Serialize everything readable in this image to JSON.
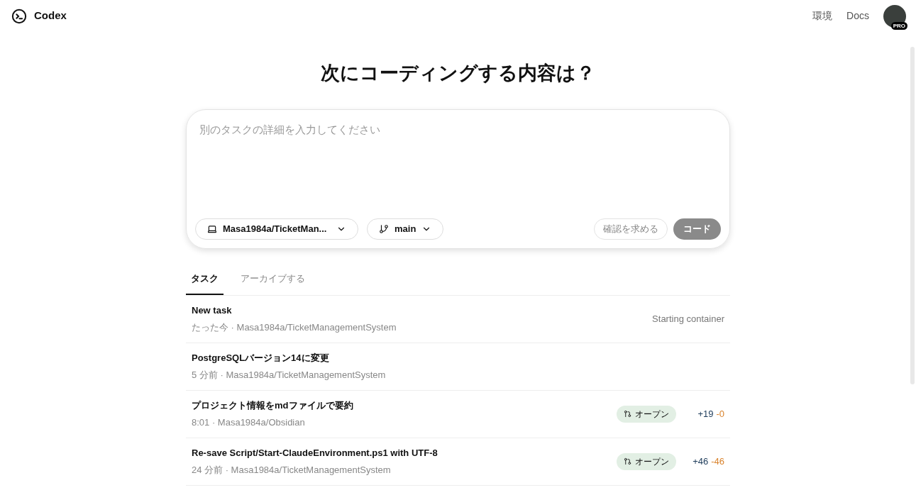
{
  "header": {
    "brand": "Codex",
    "links": [
      "環境",
      "Docs"
    ],
    "avatar_badge": "PRO"
  },
  "heading": "次にコーディングする内容は？",
  "composer": {
    "placeholder": "別のタスクの詳細を入力してください",
    "repo": "Masa1984a/TicketMan...",
    "branch": "main",
    "ask_button": "確認を求める",
    "code_button": "コード"
  },
  "tabs": [
    {
      "label": "タスク",
      "selected": true
    },
    {
      "label": "アーカイブする",
      "selected": false
    }
  ],
  "tasks": [
    {
      "title": "New task",
      "meta": "たった今 · Masa1984a/TicketManagementSystem",
      "kind": "status",
      "status": "Starting container"
    },
    {
      "title": "PostgreSQLバージョン14に変更",
      "meta": "5 分前 · Masa1984a/TicketManagementSystem",
      "kind": "plain"
    },
    {
      "title": "プロジェクト情報をmdファイルで要約",
      "meta": "8:01 · Masa1984a/Obsidian",
      "kind": "pr",
      "badge": "オープン",
      "added": "+19",
      "removed": "-0"
    },
    {
      "title": "Re-save Script/Start-ClaudeEnvironment.ps1 with UTF-8",
      "meta": "24 分前 · Masa1984a/TicketManagementSystem",
      "kind": "pr",
      "badge": "オープン",
      "added": "+46",
      "removed": "-46"
    }
  ]
}
